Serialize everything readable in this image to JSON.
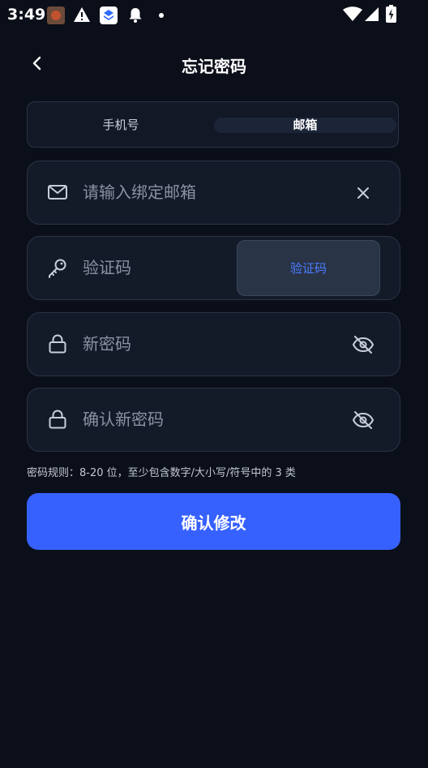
{
  "status_bar": {
    "time": "3:49",
    "icons": [
      "app-notification-icon",
      "warning-icon",
      "app-layers-icon",
      "bell-icon",
      "dot-icon",
      "wifi-icon",
      "signal-icon",
      "battery-charging-icon"
    ]
  },
  "header": {
    "title": "忘记密码",
    "back_icon": "chevron-left-icon"
  },
  "tabs": [
    {
      "label": "手机号",
      "selected": false
    },
    {
      "label": "邮箱",
      "selected": true
    }
  ],
  "fields": {
    "email": {
      "placeholder": "请输入绑定邮箱",
      "value": "",
      "icon": "mail-icon",
      "trailing_icon": "clear-icon"
    },
    "code": {
      "placeholder": "验证码",
      "value": "",
      "icon": "key-icon",
      "button_label": "验证码"
    },
    "new_password": {
      "placeholder": "新密码",
      "value": "",
      "icon": "lock-icon",
      "trailing_icon": "eye-off-icon"
    },
    "confirm_password": {
      "placeholder": "确认新密码",
      "value": "",
      "icon": "lock-icon",
      "trailing_icon": "eye-off-icon"
    }
  },
  "hint": "密码规则：8-20 位，至少包含数字/大小写/符号中的 3 类",
  "submit_label": "确认修改",
  "colors": {
    "background": "#0b0f19",
    "field_background": "#131a28",
    "accent": "#3661ff",
    "code_button_text": "#4a7dff",
    "placeholder": "#8b93a3"
  }
}
